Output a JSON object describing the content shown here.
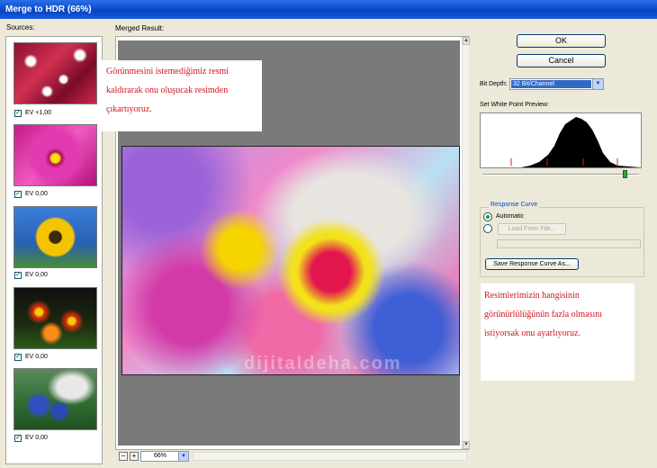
{
  "window": {
    "title": "Merge to HDR (66%)"
  },
  "sources": {
    "label": "Sources:",
    "items": [
      {
        "ev": "EV +1,00",
        "checked": true
      },
      {
        "ev": "EV 0,00",
        "checked": true
      },
      {
        "ev": "EV 0,00",
        "checked": true
      },
      {
        "ev": "EV 0,00",
        "checked": true
      },
      {
        "ev": "EV 0,00",
        "checked": true
      }
    ]
  },
  "preview": {
    "label": "Merged Result:",
    "watermark": "dijitaldeha.com",
    "zoom": "66%",
    "zoom_minus": "−",
    "zoom_plus": "+"
  },
  "buttons": {
    "ok": "OK",
    "cancel": "Cancel",
    "load_from_file": "Load From File...",
    "save_response_curve": "Save Response Curve As..."
  },
  "bit_depth": {
    "label": "Bit Depth:",
    "value": "32 Bit/Channel"
  },
  "white_point": {
    "label": "Set White Point Preview:"
  },
  "response_curve": {
    "title": "Response Curve",
    "automatic_label": "Automatic",
    "selected": "Automatic"
  },
  "annotations": {
    "top_lines": [
      "Görünmesini istemediğimiz resmi",
      "kaldırarak onu oluşucak resimden",
      "çıkartıyoruz."
    ],
    "bottom_lines": [
      "Resimlerimizin hangisinin",
      "görünürlülüğünün fazla olmasını",
      "istiyorsak onu ayarlıyoruz."
    ]
  },
  "colors": {
    "titlebar": "#0a4fd1",
    "annotation_text": "#d4141d",
    "selection": "#316ac5",
    "check": "#21a121"
  },
  "icons": {
    "checkbox": "checkmark-icon",
    "dropdown": "chevron-down-icon",
    "scroll_up": "arrow-up-icon",
    "scroll_down": "arrow-down-icon"
  }
}
